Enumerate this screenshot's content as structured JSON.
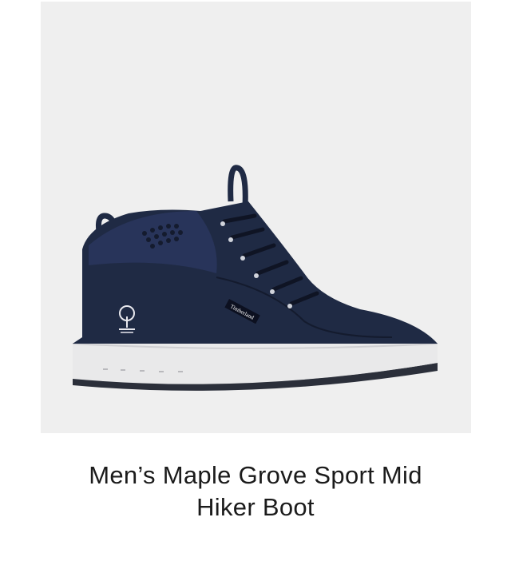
{
  "product": {
    "title_line1": "Men’s Maple Grove Sport Mid",
    "title_line2": "Hiker Boot",
    "image_icon": "shoe-product-image",
    "brand_tag_text": "Timberland"
  },
  "colors": {
    "image_background": "#efefef",
    "upper": "#1f2a44",
    "sole": "#e9e9ea",
    "outsole": "#2b2f3a"
  }
}
